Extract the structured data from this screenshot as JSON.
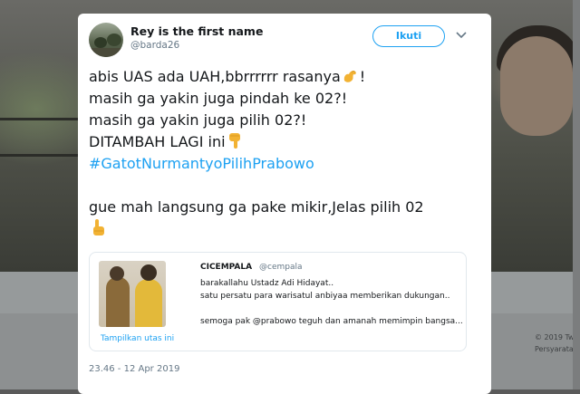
{
  "background": {
    "footer_line1": "© 2019 Twitt",
    "footer_line2": "Persyarata"
  },
  "tweet": {
    "author_name": "Rey is the first name",
    "author_handle": "@barda26",
    "follow_label": "Ikuti",
    "lines": {
      "l1": "abis UAS ada UAH,bbrrrrrr rasanya",
      "l1_end": "!",
      "l2": "masih ga yakin juga pindah ke 02?!",
      "l3": "masih ga yakin juga pilih 02?!",
      "l4": "DITAMBAH LAGI ini",
      "hashtag": "#GatotNurmantyoPilihPrabowo",
      "l6": "gue mah langsung ga pake mikir,Jelas pilih 02"
    },
    "timestamp": "23.46 - 12 Apr 2019"
  },
  "quoted_tweet": {
    "name": "CICEMPALA",
    "handle": "@cempala",
    "line1": "barakallahu Ustadz Adi Hidayat..",
    "line2": "satu persatu para warisatul anbiyaa memberikan dukungan..",
    "line3": "semoga pak @prabowo teguh dan amanah memimpin bangsa...",
    "show_thread": "Tampilkan utas ini"
  },
  "icons": [
    "chevron-down-icon",
    "flexed-biceps-emoji",
    "pointing-down-emoji",
    "pointing-up-emoji"
  ],
  "colors": {
    "accent": "#1da1f2",
    "text": "#14171a",
    "muted": "#657786",
    "overlay": "#5a5a5a"
  }
}
